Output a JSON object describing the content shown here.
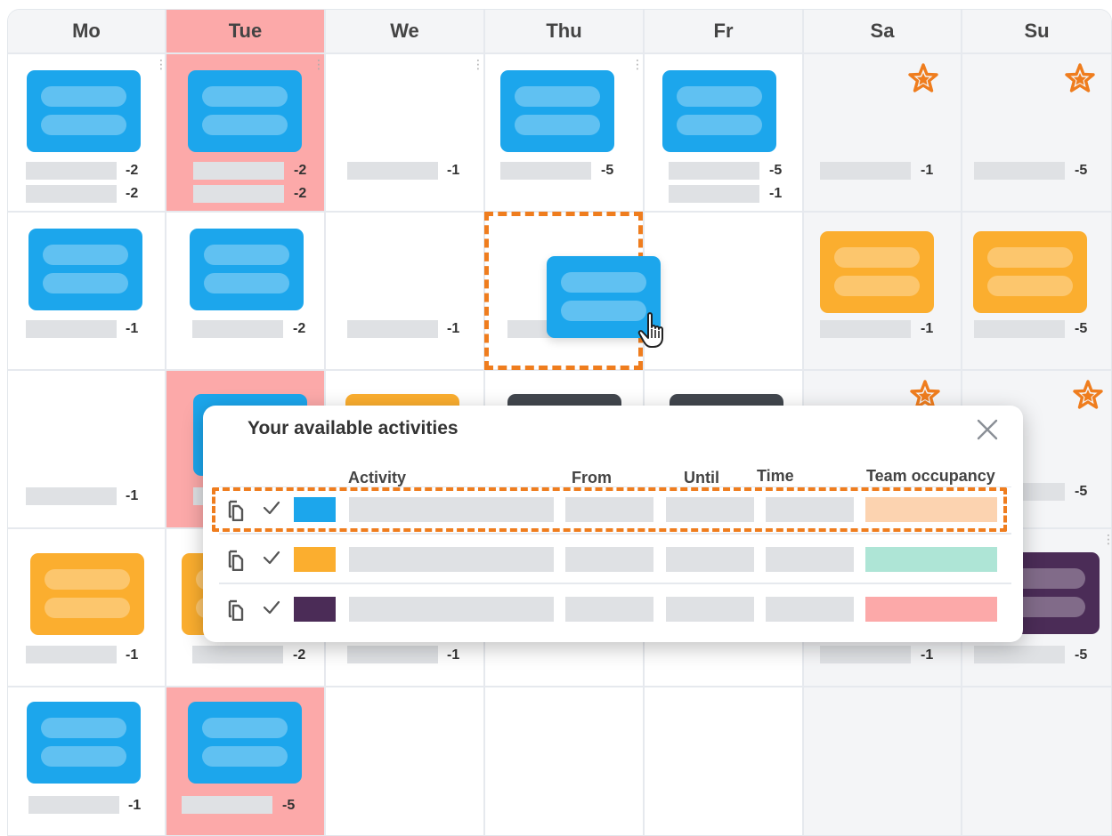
{
  "calendar": {
    "days": [
      "Mo",
      "Tue",
      "We",
      "Thu",
      "Fr",
      "Sa",
      "Su"
    ],
    "highlighted_day": "Tue",
    "weekend_days": [
      "Sa",
      "Su"
    ],
    "rows": [
      [
        "-2|-2",
        "-2|-2",
        "-1",
        "-5",
        "-5|-1",
        "-1",
        "-5"
      ],
      [
        "-1",
        "-2",
        "-1",
        "",
        "",
        "-1",
        "-5"
      ],
      [
        "-1",
        "",
        "",
        "",
        "",
        "",
        "-5"
      ],
      [
        "-1",
        "-2",
        "-1",
        "",
        "",
        "-1",
        "-5"
      ],
      [
        "-1",
        "-5",
        "",
        "",
        "",
        "",
        ""
      ]
    ],
    "row1": {
      "mo_a": "-2",
      "mo_b": "-2",
      "tue_a": "-2",
      "tue_b": "-2",
      "we": "-1",
      "thu": "-5",
      "fr_a": "-5",
      "fr_b": "-1",
      "sa": "-1",
      "su": "-5"
    },
    "row2": {
      "mo": "-1",
      "tue": "-2",
      "we": "-1",
      "sa": "-1",
      "su": "-5"
    },
    "row3": {
      "mo": "-1",
      "su": "-5"
    },
    "row4": {
      "mo": "-1",
      "tue": "-2",
      "we": "-1",
      "sa": "-1",
      "su": "-5"
    },
    "row5": {
      "mo": "-1",
      "tue": "-5"
    }
  },
  "colors": {
    "blue": "#1ca6ec",
    "orange": "#fbae2f",
    "dark": "#42474e",
    "purple": "#4b2c57",
    "highlight": "#fca9a9",
    "dashed_accent": "#ef7d1e",
    "star": "#ef7d1e"
  },
  "icons": [
    "star-icon",
    "more-vertical-icon",
    "hand-cursor-icon",
    "close-icon",
    "copy-icon",
    "check-icon"
  ],
  "modal": {
    "title": "Your available activities",
    "columns": {
      "activity": "Activity",
      "from": "From",
      "until": "Until",
      "time": "Time",
      "team_occupancy": "Team occupancy"
    },
    "rows": [
      {
        "swatch": "#1ca6ec",
        "occupancy_color": "#fcd3b0",
        "selected": true
      },
      {
        "swatch": "#fbae2f",
        "occupancy_color": "#aee5d6",
        "selected": false
      },
      {
        "swatch": "#4b2c57",
        "occupancy_color": "#fca9a9",
        "selected": false
      }
    ]
  }
}
